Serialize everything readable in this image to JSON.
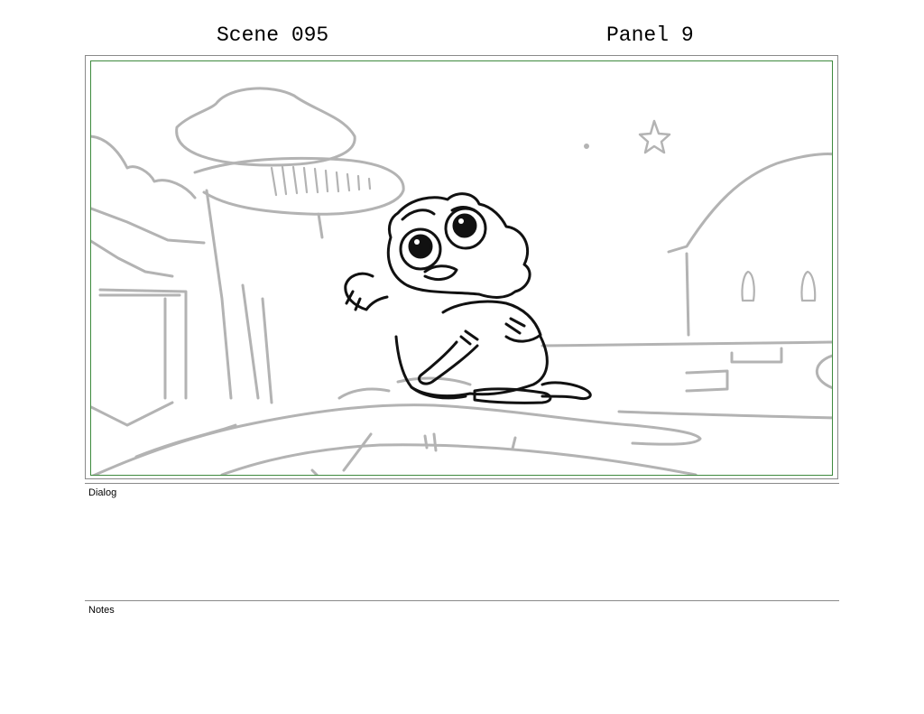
{
  "header": {
    "scene": "Scene 095",
    "panel": "Panel 9"
  },
  "sections": {
    "dialog_label": "Dialog",
    "dialog_text": "",
    "notes_label": "Notes",
    "notes_text": ""
  }
}
